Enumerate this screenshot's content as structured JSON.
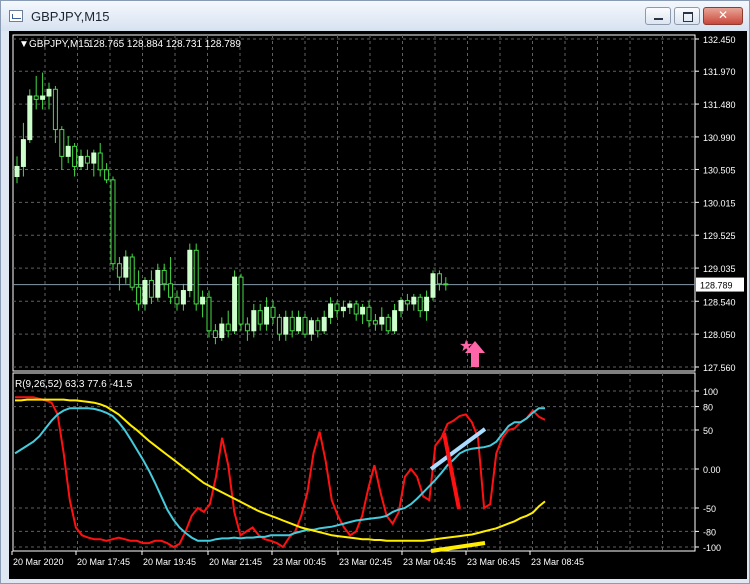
{
  "window": {
    "title": "GBPJPY,M15",
    "buttons": [
      "minimize",
      "maximize",
      "close"
    ]
  },
  "chart_header": {
    "symbol": "GBPJPY,M15",
    "ohlc": "128.765 128.884 128.731 128.789"
  },
  "indicator_label": "R(9,26,52) 63.3 77.6 -41.5",
  "colors": {
    "background": "#000000",
    "grid": "#606060",
    "bull_candle": "#ccffcc",
    "wick": "#44dd44",
    "red_line": "#ff1111",
    "cyan_line": "#44ccdd",
    "yellow_line": "#ffee00",
    "annotation_pink": "#ff66aa",
    "annotation_lightblue": "#aaddff"
  },
  "chart_data": {
    "type": "candlestick",
    "price_axis_labels": [
      "132.450",
      "131.970",
      "131.480",
      "130.990",
      "130.505",
      "130.015",
      "129.525",
      "129.035",
      "128.540",
      "128.050",
      "127.560"
    ],
    "current_price": "128.789",
    "indicator_axis_labels": [
      "100",
      "80",
      "50",
      "0.00",
      "-50",
      "-80",
      "-100"
    ],
    "time_labels": [
      "20 Mar 2020",
      "20 Mar 17:45",
      "20 Mar 19:45",
      "20 Mar 21:45",
      "23 Mar 00:45",
      "23 Mar 02:45",
      "23 Mar 04:45",
      "23 Mar 06:45",
      "23 Mar 08:45"
    ],
    "candles": [
      [
        130.4,
        130.7,
        130.3,
        130.55
      ],
      [
        130.55,
        131.2,
        130.4,
        130.95
      ],
      [
        130.95,
        131.7,
        130.9,
        131.6
      ],
      [
        131.6,
        131.9,
        131.4,
        131.55
      ],
      [
        131.55,
        131.95,
        131.4,
        131.6
      ],
      [
        131.6,
        131.8,
        131.4,
        131.7
      ],
      [
        131.7,
        131.75,
        130.9,
        131.1
      ],
      [
        131.1,
        131.15,
        130.5,
        130.7
      ],
      [
        130.7,
        131.0,
        130.6,
        130.85
      ],
      [
        130.85,
        130.9,
        130.4,
        130.55
      ],
      [
        130.55,
        130.8,
        130.5,
        130.7
      ],
      [
        130.7,
        130.8,
        130.5,
        130.6
      ],
      [
        130.6,
        130.8,
        130.4,
        130.75
      ],
      [
        130.75,
        130.9,
        130.4,
        130.5
      ],
      [
        130.5,
        130.6,
        130.3,
        130.35
      ],
      [
        130.35,
        130.4,
        129.0,
        129.1
      ],
      [
        129.1,
        129.2,
        128.7,
        128.9
      ],
      [
        128.9,
        129.3,
        128.8,
        129.2
      ],
      [
        129.2,
        129.25,
        128.7,
        128.75
      ],
      [
        128.75,
        129.0,
        128.4,
        128.5
      ],
      [
        128.5,
        128.9,
        128.4,
        128.85
      ],
      [
        128.85,
        129.0,
        128.5,
        128.6
      ],
      [
        128.6,
        129.1,
        128.55,
        129.0
      ],
      [
        129.0,
        129.1,
        128.7,
        128.8
      ],
      [
        128.8,
        129.2,
        128.5,
        128.6
      ],
      [
        128.6,
        128.7,
        128.4,
        128.5
      ],
      [
        128.5,
        128.8,
        128.4,
        128.7
      ],
      [
        128.7,
        129.4,
        128.6,
        129.3
      ],
      [
        129.3,
        129.4,
        128.4,
        128.5
      ],
      [
        128.5,
        128.7,
        128.3,
        128.6
      ],
      [
        128.6,
        128.7,
        128.0,
        128.1
      ],
      [
        128.1,
        128.2,
        127.9,
        128.0
      ],
      [
        128.0,
        128.3,
        127.95,
        128.2
      ],
      [
        128.2,
        128.4,
        128.0,
        128.1
      ],
      [
        128.1,
        129.0,
        128.05,
        128.9
      ],
      [
        128.9,
        128.95,
        128.1,
        128.2
      ],
      [
        128.2,
        128.3,
        127.95,
        128.1
      ],
      [
        128.1,
        128.5,
        128.0,
        128.4
      ],
      [
        128.4,
        128.5,
        128.1,
        128.2
      ],
      [
        128.2,
        128.6,
        128.1,
        128.45
      ],
      [
        128.45,
        128.55,
        128.2,
        128.3
      ],
      [
        128.3,
        128.35,
        127.95,
        128.05
      ],
      [
        128.05,
        128.4,
        127.95,
        128.3
      ],
      [
        128.3,
        128.4,
        128.0,
        128.1
      ],
      [
        128.1,
        128.4,
        128.05,
        128.3
      ],
      [
        128.3,
        128.35,
        128.0,
        128.05
      ],
      [
        128.05,
        128.3,
        127.95,
        128.25
      ],
      [
        128.25,
        128.3,
        128.0,
        128.1
      ],
      [
        128.1,
        128.4,
        128.05,
        128.3
      ],
      [
        128.3,
        128.6,
        128.2,
        128.5
      ],
      [
        128.5,
        128.55,
        128.3,
        128.4
      ],
      [
        128.4,
        128.55,
        128.3,
        128.45
      ],
      [
        128.45,
        128.55,
        128.35,
        128.5
      ],
      [
        128.5,
        128.55,
        128.25,
        128.35
      ],
      [
        128.35,
        128.5,
        128.2,
        128.45
      ],
      [
        128.45,
        128.55,
        128.15,
        128.25
      ],
      [
        128.25,
        128.35,
        128.1,
        128.2
      ],
      [
        128.2,
        128.45,
        128.1,
        128.3
      ],
      [
        128.3,
        128.35,
        128.05,
        128.1
      ],
      [
        128.1,
        128.5,
        128.05,
        128.4
      ],
      [
        128.4,
        128.6,
        128.3,
        128.55
      ],
      [
        128.55,
        128.65,
        128.4,
        128.5
      ],
      [
        128.5,
        128.65,
        128.4,
        128.6
      ],
      [
        128.6,
        128.65,
        128.3,
        128.4
      ],
      [
        128.4,
        128.7,
        128.25,
        128.6
      ],
      [
        128.6,
        129.0,
        128.55,
        128.95
      ],
      [
        128.95,
        129.0,
        128.7,
        128.8
      ],
      [
        128.8,
        128.9,
        128.7,
        128.79
      ]
    ],
    "indicator_series": [
      {
        "name": "red",
        "color": "#ff1111",
        "values": [
          92,
          92,
          92,
          92,
          90,
          88,
          85,
          70,
          20,
          -40,
          -75,
          -85,
          -88,
          -90,
          -90,
          -92,
          -90,
          -88,
          -90,
          -92,
          -92,
          -95,
          -95,
          -92,
          -92,
          -95,
          -100,
          -96,
          -80,
          -60,
          -50,
          -55,
          -45,
          -10,
          40,
          5,
          -55,
          -85,
          -80,
          -75,
          -85,
          -90,
          -92,
          -95,
          -100,
          -88,
          -80,
          -60,
          -30,
          20,
          48,
          10,
          -40,
          -60,
          -75,
          -85,
          -80,
          -60,
          -25,
          5,
          -30,
          -60,
          -70,
          -55,
          -10,
          0,
          -10,
          -35,
          -40,
          30,
          40,
          58,
          62,
          68,
          70,
          60,
          40,
          -50,
          -45,
          20,
          40,
          50,
          52,
          60,
          65,
          75,
          67,
          63
        ]
      },
      {
        "name": "cyan",
        "color": "#44ccdd",
        "values": [
          20,
          25,
          30,
          35,
          42,
          52,
          62,
          70,
          75,
          78,
          78,
          78,
          78,
          77,
          75,
          72,
          68,
          60,
          50,
          38,
          25,
          12,
          -2,
          -18,
          -35,
          -52,
          -65,
          -75,
          -82,
          -88,
          -92,
          -92,
          -92,
          -90,
          -89,
          -89,
          -88,
          -89,
          -88,
          -88,
          -87,
          -87,
          -85,
          -85,
          -85,
          -85,
          -82,
          -80,
          -78,
          -78,
          -76,
          -75,
          -74,
          -72,
          -70,
          -68,
          -66,
          -65,
          -64,
          -63,
          -62,
          -60,
          -55,
          -52,
          -50,
          -45,
          -38,
          -30,
          -22,
          -14,
          -5,
          5,
          12,
          20,
          24,
          26,
          27,
          28,
          30,
          35,
          45,
          55,
          60,
          60,
          65,
          72,
          78,
          78
        ]
      },
      {
        "name": "yellow",
        "color": "#ffee00",
        "values": [
          88,
          88,
          89,
          89,
          89,
          89,
          89,
          89,
          89,
          88,
          88,
          87,
          86,
          85,
          83,
          80,
          75,
          70,
          63,
          56,
          50,
          43,
          36,
          30,
          24,
          18,
          12,
          6,
          0,
          -6,
          -12,
          -18,
          -22,
          -26,
          -30,
          -34,
          -38,
          -42,
          -46,
          -50,
          -54,
          -57,
          -60,
          -63,
          -66,
          -69,
          -72,
          -75,
          -77,
          -79,
          -81,
          -83,
          -85,
          -86,
          -87,
          -88,
          -89,
          -90,
          -90,
          -91,
          -91,
          -92,
          -92,
          -92,
          -92,
          -92,
          -92,
          -92,
          -91,
          -90,
          -89,
          -88,
          -87,
          -86,
          -85,
          -84,
          -82,
          -80,
          -78,
          -76,
          -73,
          -70,
          -67,
          -63,
          -60,
          -56,
          -48,
          -41.5
        ]
      }
    ],
    "annotations": [
      {
        "type": "star",
        "color": "#ff66aa"
      },
      {
        "type": "up-arrow",
        "color": "#ff66aa"
      },
      {
        "type": "rising-line",
        "color": "#aaddff"
      },
      {
        "type": "falling-line",
        "color": "#ff1111"
      },
      {
        "type": "rising-line",
        "color": "#ffee00"
      }
    ]
  }
}
